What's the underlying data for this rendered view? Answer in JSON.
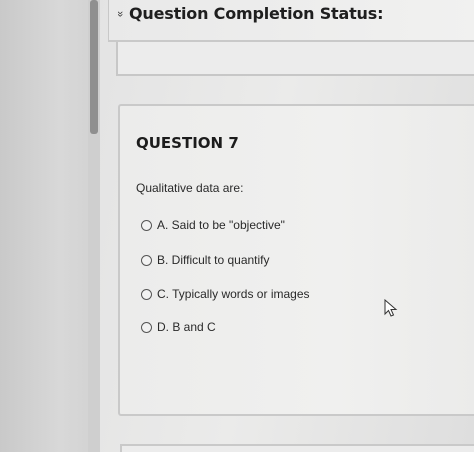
{
  "status": {
    "chevron": "»",
    "title": "Question Completion Status:"
  },
  "question": {
    "title": "QUESTION 7",
    "prompt": "Qualitative data are:",
    "options": [
      {
        "label": "A. Said to be \"objective\"",
        "selected": false
      },
      {
        "label": "B. Difficult to quantify",
        "selected": false
      },
      {
        "label": "C. Typically words or images",
        "selected": false
      },
      {
        "label": "D. B and C",
        "selected": false
      }
    ]
  },
  "icons": {
    "cursor": "mouse-pointer-icon",
    "radio": "radio-button-icon",
    "chevron": "double-chevron-down-icon"
  },
  "colors": {
    "background": "#e6e6e5",
    "border": "#c9c9c9",
    "text": "#2a2a2a",
    "scroll_thumb": "#8f8f8f"
  }
}
